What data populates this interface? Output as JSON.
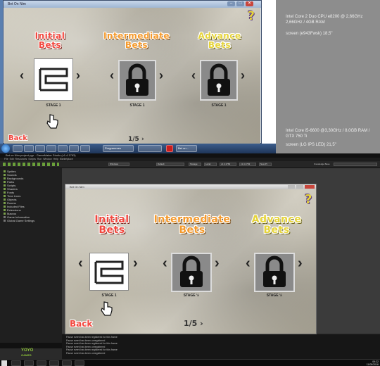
{
  "top_window": {
    "title": "Bet On Nim",
    "game": {
      "stages": [
        {
          "title": "Initial Bets",
          "caption": "STAGE 1",
          "locked": false,
          "color": "#f2483f"
        },
        {
          "title": "Intermediate Bets",
          "caption": "STAGE 1",
          "locked": true,
          "color": "#f59a2c"
        },
        {
          "title": "Advance Bets",
          "caption": "STAGE 1",
          "locked": true,
          "color": "#e6d43a"
        }
      ],
      "back": "Back",
      "pager": "1/5",
      "help": "?"
    },
    "taskbar_items": [
      "",
      "",
      "",
      "",
      "",
      "",
      "",
      "Programmes",
      "",
      "",
      "Bet on...",
      ""
    ]
  },
  "notes": {
    "pc1_specs": "Intel Core 2 Duo CPU e8200 @ 2,66GHz 2,66GHz / 4GB RAM",
    "pc1_screen": "screen (e943Fwsk) 18,5\"",
    "pc2_specs": "Intel Core i5-6600 @3,30GHz / 8,0GB RAM / GTX 750 Ti",
    "pc2_screen": "screen (LG IPS LED) 21,5\""
  },
  "ide": {
    "title": "Bet on Nim.project.yyp - GameMaker Studio (v1.4.1763)",
    "menu": "File  Edit  Resources  Scripts  Run  Window  Help  Marketplace",
    "toolbar": {
      "target": "Windows",
      "config": "Default",
      "storage": "Storage",
      "device": "Local",
      "version": "v1.4.1763",
      "version2": "v1.4.1763",
      "new_pt": "New Pt",
      "knowledge_base": "Knowledge Base"
    },
    "resource_tree": [
      "Sprites",
      "Sounds",
      "Backgrounds",
      "Paths",
      "Scripts",
      "Shaders",
      "Fonts",
      "Time Lines",
      "Objects",
      "Rooms",
      "Included Files",
      "Extensions",
      "Macros",
      "Game Information",
      "Global Game Settings"
    ],
    "game_window_title": "Bet On Nim",
    "game": {
      "stages": [
        {
          "title": "Initial Bets",
          "caption": "STAGE 1",
          "locked": false
        },
        {
          "title": "Intermediate Bets",
          "caption": "STAGE ½",
          "locked": true
        },
        {
          "title": "Advance Bets",
          "caption": "STAGE ½",
          "locked": true
        }
      ],
      "back": "Back",
      "pager": "1/5",
      "help": "?"
    },
    "output_lines": [
      "Pause event has been registered for this frame",
      "Pause event has been unregistered",
      "Pause event has been registered for this frame",
      "Pause event has been unregistered",
      "Pause event has been registered for this frame",
      "Pause event has been unregistered"
    ],
    "logo": {
      "line1": "YOYO",
      "line2": "GAMES"
    },
    "clock": {
      "time": "09:22",
      "date": "11/05/2016"
    }
  }
}
